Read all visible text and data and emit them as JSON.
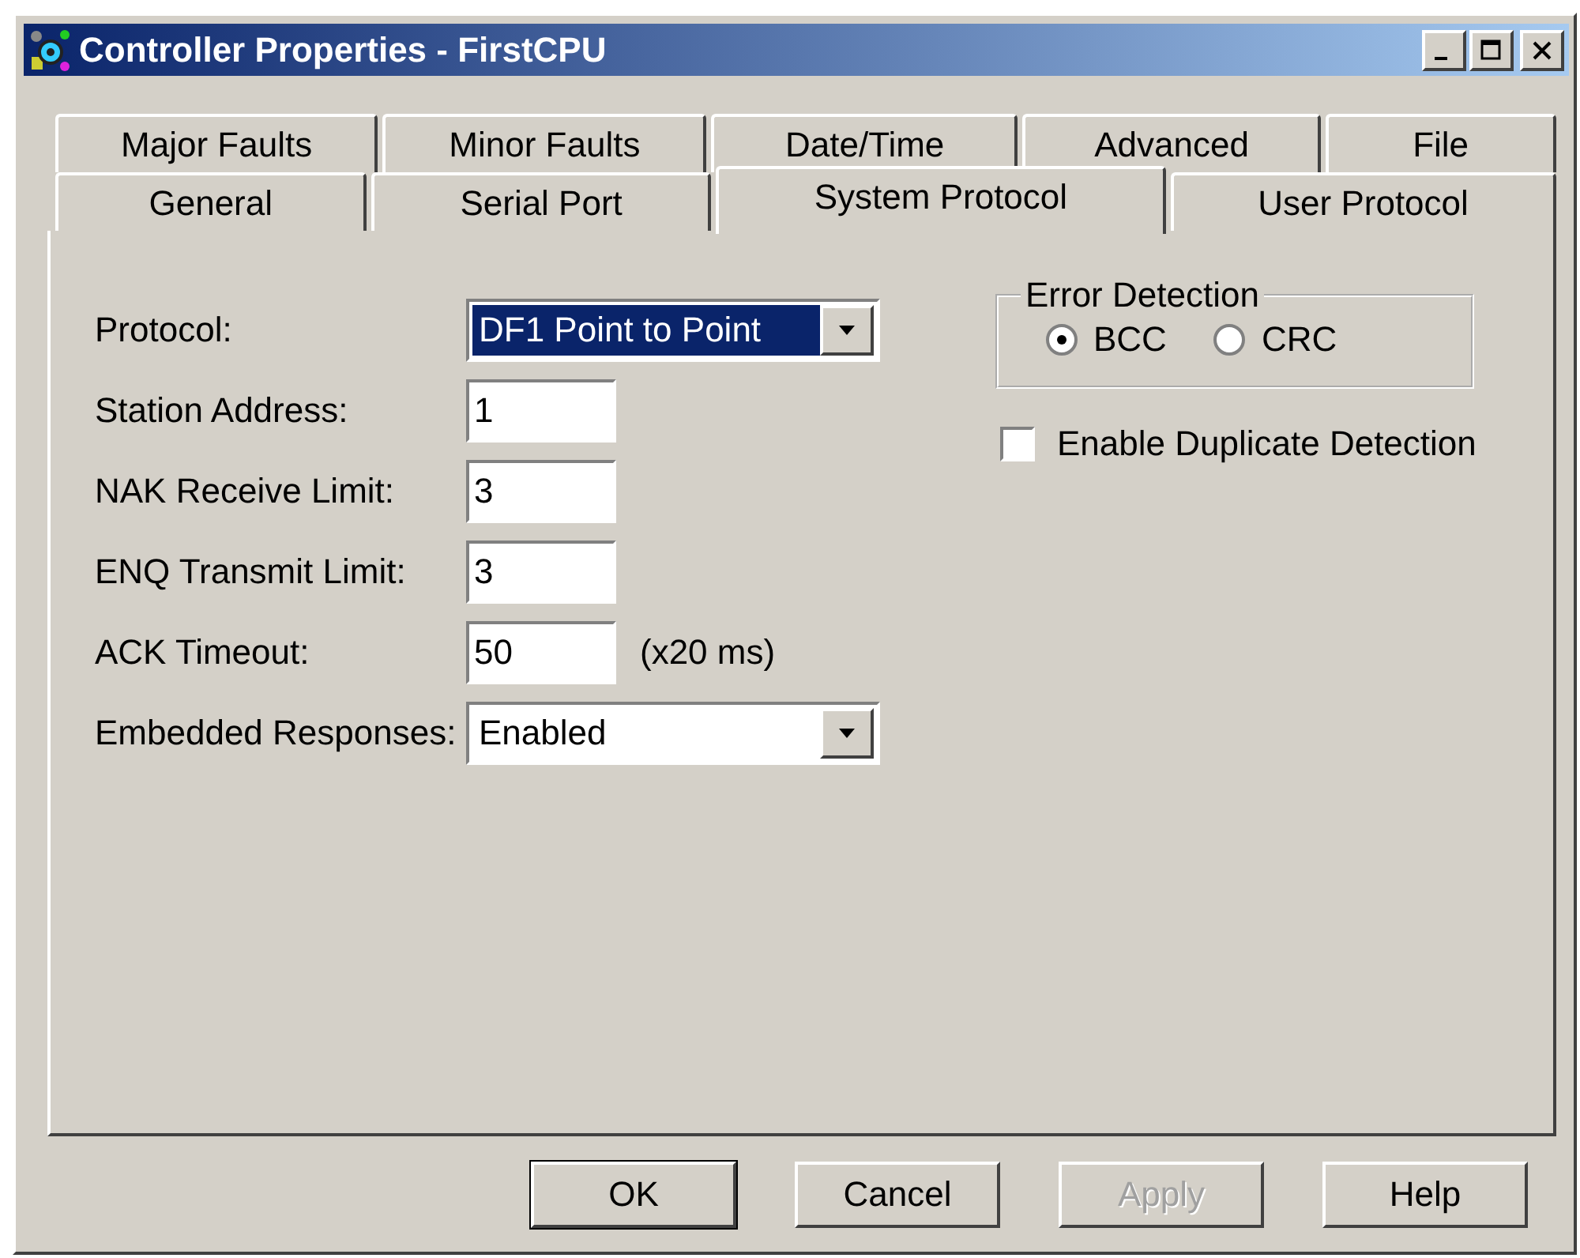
{
  "window": {
    "title": "Controller Properties - FirstCPU"
  },
  "tab_rows": [
    [
      {
        "label": "Major Faults",
        "selected": false
      },
      {
        "label": "Minor Faults",
        "selected": false
      },
      {
        "label": "Date/Time",
        "selected": false
      },
      {
        "label": "Advanced",
        "selected": false
      },
      {
        "label": "File",
        "selected": false
      }
    ],
    [
      {
        "label": "General",
        "selected": false
      },
      {
        "label": "Serial Port",
        "selected": false
      },
      {
        "label": "System Protocol",
        "selected": true
      },
      {
        "label": "User Protocol",
        "selected": false
      }
    ]
  ],
  "fields": [
    {
      "kind": "select",
      "label": "Protocol:",
      "value": "DF1 Point to Point",
      "focused": true
    },
    {
      "kind": "text",
      "label": "Station Address:",
      "value": "1"
    },
    {
      "kind": "text",
      "label": "NAK Receive Limit:",
      "value": "3"
    },
    {
      "kind": "text",
      "label": "ENQ Transmit Limit:",
      "value": "3"
    },
    {
      "kind": "text",
      "label": "ACK Timeout:",
      "value": "50",
      "unit": "(x20 ms)"
    },
    {
      "kind": "select",
      "label": "Embedded Responses:",
      "value": "Enabled",
      "focused": false
    }
  ],
  "error_detection": {
    "title": "Error Detection",
    "options": [
      {
        "label": "BCC",
        "selected": true
      },
      {
        "label": "CRC",
        "selected": false
      }
    ]
  },
  "duplicate_detection": {
    "label": "Enable Duplicate Detection",
    "checked": false
  },
  "buttons": [
    {
      "label": "OK",
      "default": true,
      "disabled": false
    },
    {
      "label": "Cancel",
      "default": false,
      "disabled": false
    },
    {
      "label": "Apply",
      "default": false,
      "disabled": true
    },
    {
      "label": "Help",
      "default": false,
      "disabled": false
    }
  ]
}
